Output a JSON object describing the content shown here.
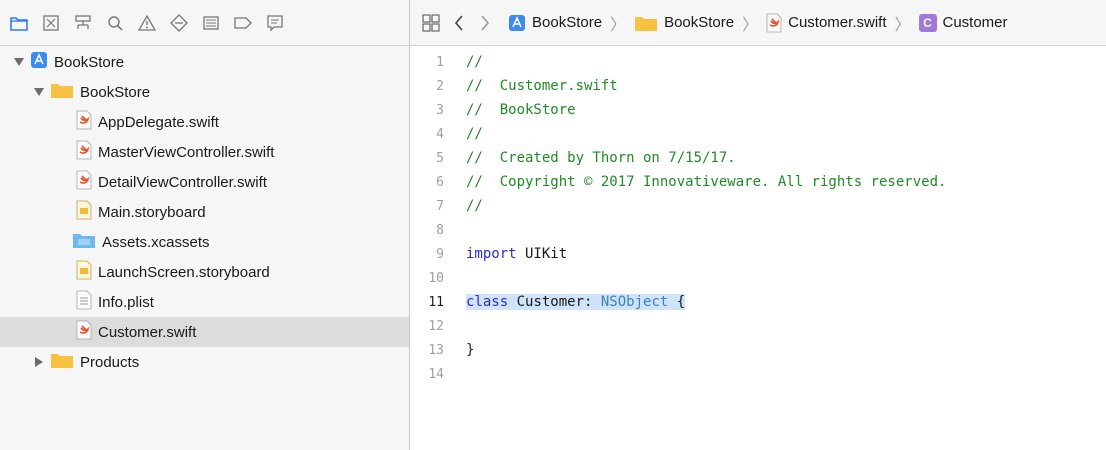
{
  "navigator_toolbar": {
    "icons": [
      "folder-icon",
      "source-control-icon",
      "symbol-icon",
      "search-icon",
      "warning-icon",
      "test-icon",
      "debug-icon",
      "breakpoint-icon",
      "report-icon"
    ]
  },
  "navigator": {
    "items": [
      {
        "label": "BookStore",
        "icon": "project-icon",
        "level": 0,
        "expanded": true
      },
      {
        "label": "BookStore",
        "icon": "folder-icon",
        "level": 1,
        "expanded": true
      },
      {
        "label": "AppDelegate.swift",
        "icon": "swift-file-icon",
        "level": 2
      },
      {
        "label": "MasterViewController.swift",
        "icon": "swift-file-icon",
        "level": 2
      },
      {
        "label": "DetailViewController.swift",
        "icon": "swift-file-icon",
        "level": 2
      },
      {
        "label": "Main.storyboard",
        "icon": "storyboard-icon",
        "level": 2
      },
      {
        "label": "Assets.xcassets",
        "icon": "assets-icon",
        "level": 2
      },
      {
        "label": "LaunchScreen.storyboard",
        "icon": "storyboard-icon",
        "level": 2
      },
      {
        "label": "Info.plist",
        "icon": "plist-icon",
        "level": 2
      },
      {
        "label": "Customer.swift",
        "icon": "swift-file-icon",
        "level": 2,
        "selected": true
      },
      {
        "label": "Products",
        "icon": "folder-icon",
        "level": 1,
        "expanded": false
      }
    ]
  },
  "jumpbar": {
    "crumbs": [
      {
        "label": "BookStore",
        "icon": "project-icon"
      },
      {
        "label": "BookStore",
        "icon": "folder-icon"
      },
      {
        "label": "Customer.swift",
        "icon": "swift-file-icon"
      },
      {
        "label": "Customer",
        "icon": "class-icon"
      }
    ],
    "class_badge": "C"
  },
  "editor": {
    "current_line": 11,
    "lines": [
      {
        "n": "1",
        "text": "//"
      },
      {
        "n": "2",
        "text": "//  Customer.swift"
      },
      {
        "n": "3",
        "text": "//  BookStore"
      },
      {
        "n": "4",
        "text": "//"
      },
      {
        "n": "5",
        "text": "//  Created by Thorn on 7/15/17."
      },
      {
        "n": "6",
        "text": "//  Copyright © 2017 Innovativeware. All rights reserved."
      },
      {
        "n": "7",
        "text": "//"
      },
      {
        "n": "8",
        "text": ""
      },
      {
        "n": "9",
        "kw": "import",
        "rest": " UIKit"
      },
      {
        "n": "10",
        "text": ""
      },
      {
        "n": "11",
        "kw": "class",
        "rest": " Customer: ",
        "type": "NSObject",
        "tail": " {"
      },
      {
        "n": "12",
        "text": ""
      },
      {
        "n": "13",
        "text": "}"
      },
      {
        "n": "14",
        "text": ""
      }
    ]
  },
  "colors": {
    "comment": "#1f8a26",
    "keyword": "#2b2bd0",
    "type": "#3a82c4",
    "highlight": "#cfe3fb",
    "folder": "#f5c242",
    "selection": "#dcdcdc"
  }
}
